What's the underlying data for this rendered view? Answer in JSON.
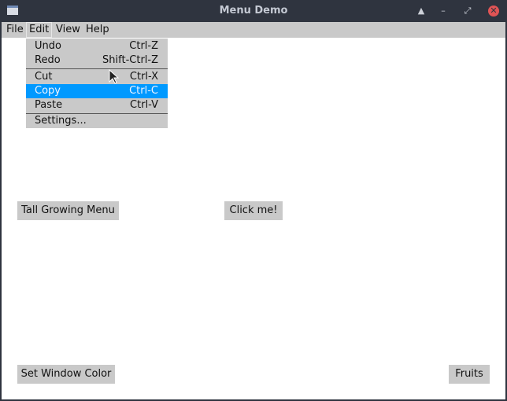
{
  "window": {
    "title": "Menu Demo",
    "controls": {
      "shade": "▲",
      "minimize": "–",
      "maximize": "⤢",
      "close": "✕"
    }
  },
  "menubar": {
    "items": [
      "File",
      "Edit",
      "View",
      "Help"
    ],
    "active": "Edit"
  },
  "edit_menu": {
    "items": [
      {
        "label": "Undo",
        "accel": "Ctrl-Z"
      },
      {
        "label": "Redo",
        "accel": "Shift-Ctrl-Z"
      },
      {
        "label": "Cut",
        "accel": "Ctrl-X"
      },
      {
        "label": "Copy",
        "accel": "Ctrl-C",
        "selected": true
      },
      {
        "label": "Paste",
        "accel": "Ctrl-V"
      },
      {
        "label": "Settings...",
        "accel": ""
      }
    ]
  },
  "buttons": {
    "tall_growing_menu": "Tall Growing Menu",
    "click_me": "Click me!",
    "set_window_color": "Set Window Color",
    "fruits": "Fruits"
  },
  "colors": {
    "titlebar": "#2f343f",
    "menubar": "#c9c9c9",
    "selection": "#0099ff",
    "close": "#e05455"
  }
}
